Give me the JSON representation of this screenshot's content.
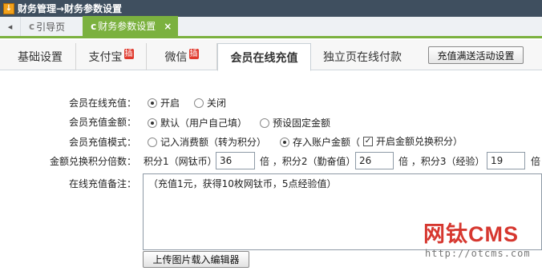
{
  "titlebar": {
    "icon": "download-arrow-icon",
    "title": "财务管理→财务参数设置"
  },
  "tabs": {
    "nav_left": "◂",
    "items": [
      {
        "icon": "c",
        "label": "引导页"
      },
      {
        "icon": "c",
        "label": "财务参数设置",
        "close": "×"
      }
    ],
    "accent": "#7bb13f"
  },
  "subtabs": [
    {
      "label": "基础设置"
    },
    {
      "label": "支付宝",
      "badge": "插"
    },
    {
      "label": "微信",
      "badge": "插"
    },
    {
      "label": "会员在线充值"
    },
    {
      "label": "独立页在线付款"
    }
  ],
  "settings_button": "充值满送活动设置",
  "form": {
    "online_recharge": {
      "label": "会员在线充值：",
      "options": [
        "开启",
        "关闭"
      ],
      "selected": 0
    },
    "recharge_amount": {
      "label": "会员充值金额：",
      "options": [
        "默认（用户自己填）",
        "预设固定金额"
      ],
      "selected": 0
    },
    "recharge_mode": {
      "label": "会员充值模式：",
      "options": [
        "记入消费额（转为积分）",
        "存入账户金额（"
      ],
      "selected": 1,
      "checkbox_label": "开启金额兑换积分）",
      "checkbox_checked": true
    },
    "multiplier": {
      "label": "金额兑换积分倍数：",
      "score1_label": "积分1（网钛币）",
      "score1_value": "36",
      "score2_label": "倍 ，积分2（勤奋值）",
      "score2_value": "26",
      "score3_label": "倍 ，积分3（经验）",
      "score3_value": "19",
      "suffix": "倍"
    },
    "note": {
      "label": "在线充值备注：",
      "value": "（充值1元，获得10枚网钛币，5点经验值）"
    },
    "upload_button": "上传图片载入编辑器"
  },
  "watermark": {
    "brand": "网钛CMS",
    "url": "http://otcms.com"
  }
}
